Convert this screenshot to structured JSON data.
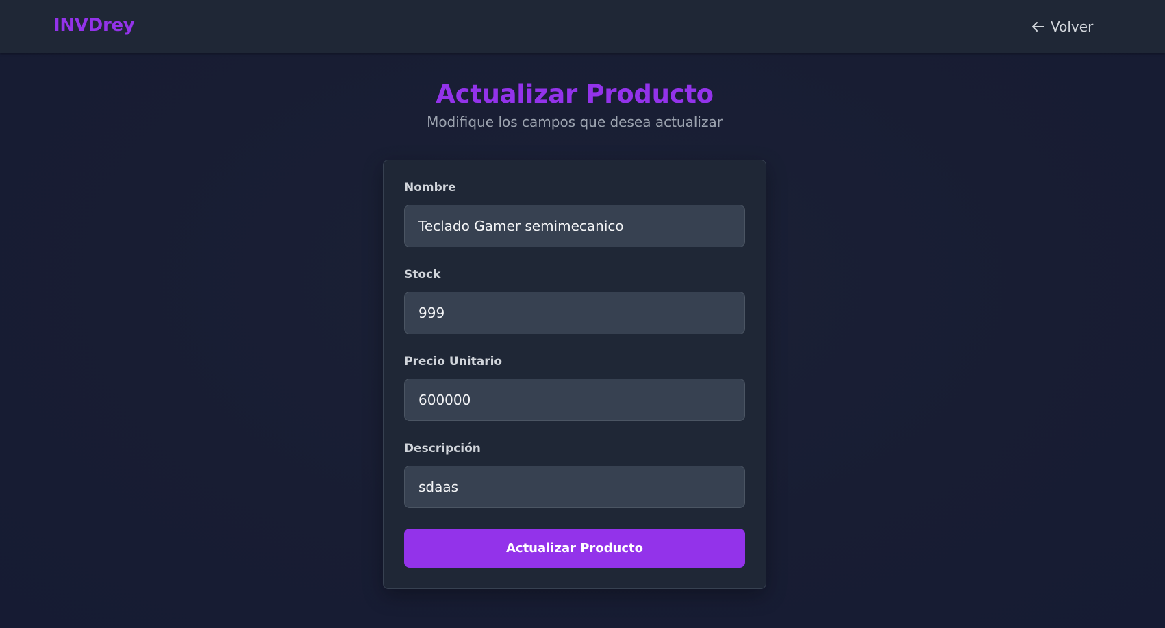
{
  "navbar": {
    "brand": "INVDrey",
    "back_label": "Volver",
    "back_icon": "arrow-left-icon"
  },
  "header": {
    "title": "Actualizar Producto",
    "subtitle": "Modifique los campos que desea actualizar"
  },
  "form": {
    "fields": [
      {
        "label": "Nombre",
        "value": "Teclado Gamer semimecanico"
      },
      {
        "label": "Stock",
        "value": "999"
      },
      {
        "label": "Precio Unitario",
        "value": "600000"
      },
      {
        "label": "Descripción",
        "value": "sdaas"
      }
    ],
    "submit_label": "Actualizar Producto"
  },
  "colors": {
    "accent": "#9333ea",
    "background": "#181d33",
    "navbar": "#1f2736",
    "card": "#1f2736",
    "input": "#374151"
  }
}
